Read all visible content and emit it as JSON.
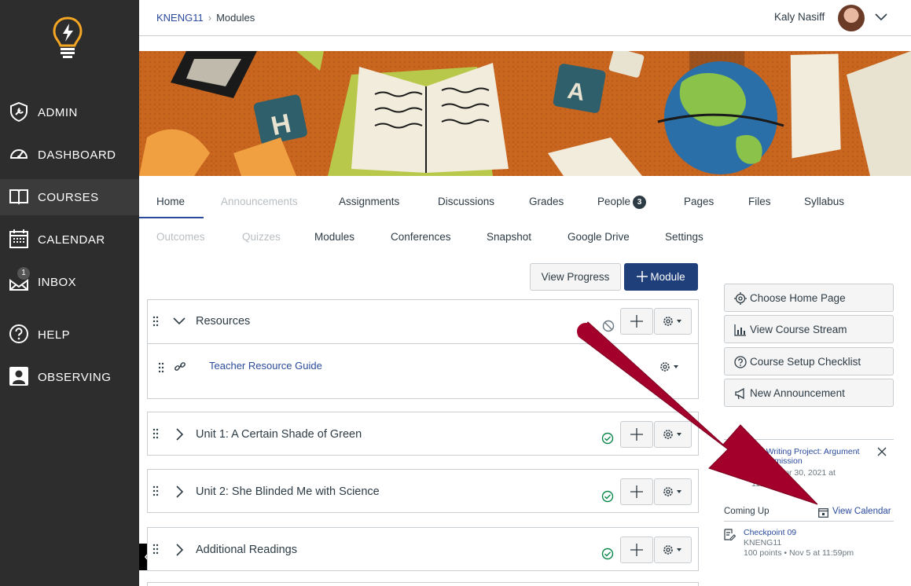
{
  "sidebar": {
    "items": [
      {
        "label": "ADMIN",
        "icon": "shield-wrench-icon"
      },
      {
        "label": "DASHBOARD",
        "icon": "speedometer-icon"
      },
      {
        "label": "COURSES",
        "icon": "book-icon"
      },
      {
        "label": "CALENDAR",
        "icon": "calendar-icon"
      },
      {
        "label": "INBOX",
        "icon": "inbox-icon"
      },
      {
        "label": "HELP",
        "icon": "question-icon"
      },
      {
        "label": "OBSERVING",
        "icon": "person-icon"
      }
    ],
    "inbox_badge": "1"
  },
  "header": {
    "course": "KNENG11",
    "page": "Modules",
    "user_name": "Kaly Nasiff"
  },
  "tabs": {
    "row1": [
      "Home",
      "Announcements",
      "Assignments",
      "Discussions",
      "Grades",
      "People",
      "Pages",
      "Files",
      "Syllabus"
    ],
    "row2": [
      "Outcomes",
      "Quizzes",
      "Modules",
      "Conferences",
      "Snapshot",
      "Google Drive",
      "Settings"
    ],
    "people_count": "3"
  },
  "toolbar": {
    "view_progress": "View Progress",
    "add_module": "Module"
  },
  "modules": [
    {
      "title": "Resources",
      "items": [
        "Teacher Resource Guide"
      ]
    },
    {
      "title": "Unit 1: A Certain Shade of Green"
    },
    {
      "title": "Unit 2: She Blinded Me with Science"
    },
    {
      "title": "Additional Readings"
    }
  ],
  "right_panel": {
    "buttons": [
      "Choose Home Page",
      "View Course Stream",
      "Course Setup Checklist",
      "New Announcement"
    ],
    "todo": {
      "title": "de Writing Project: Argument",
      "subtitle": "- Submission",
      "meta": "oints • Apr 30, 2021 at",
      "meta2": "11:59"
    },
    "coming_up_label": "Coming Up",
    "view_calendar": "View Calendar",
    "upcoming": {
      "title": "Checkpoint 09",
      "course": "KNENG11",
      "meta": "100 points • Nov 5 at 11:59pm"
    }
  },
  "colors": {
    "sidebar_bg": "#2d2d2d",
    "link": "#2a4a9b",
    "primary": "#1f3f7a",
    "success": "#0b874b",
    "annotation_arrow": "#a3002c"
  }
}
